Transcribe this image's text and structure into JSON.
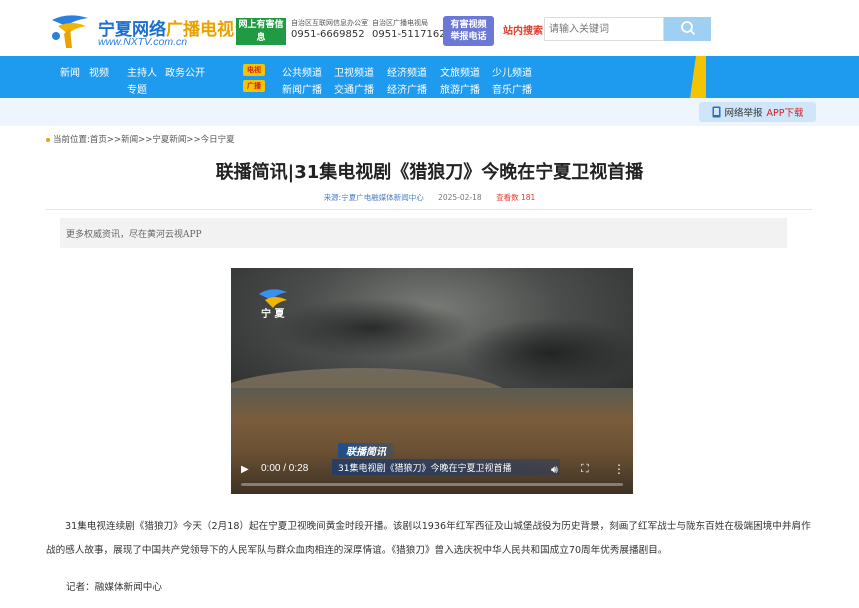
{
  "header": {
    "logo_name_a": "宁夏网络",
    "logo_name_b": "广播电视台",
    "logo_url": "www.NXTV.com.cn",
    "report_badge_line1": "网上有害信息",
    "report_badge_line2": "举报专区",
    "cyber_office": {
      "label": "自治区互联网信息办公室",
      "phone": "0951-6669852"
    },
    "radio_bureau": {
      "label": "自治区广播电视局",
      "phone": "0951-5117162"
    },
    "tv_badge_line1": "有害视频",
    "tv_badge_line2": "举报电话",
    "search_label": "站内搜索",
    "search_placeholder": "请输入关键词"
  },
  "nav": {
    "left_items": [
      "新闻",
      "视频",
      "主持人",
      "政务公开",
      "专题"
    ],
    "tv_tag": "电视",
    "radio_tag": "广播",
    "tv_channels": [
      "公共频道",
      "卫视频道",
      "经济频道",
      "文旅频道",
      "少儿频道"
    ],
    "radio_channels": [
      "新闻广播",
      "交通广播",
      "经济广播",
      "旅游广播",
      "音乐广播"
    ]
  },
  "subbar": {
    "app_label_black": "网络举报",
    "app_label_red": "APP下载"
  },
  "breadcrumb": "当前位置:首页>>新闻>>宁夏新闻>>今日宁夏",
  "article": {
    "title": "联播简讯|31集电视剧《猎狼刀》今晚在宁夏卫视首播",
    "source": "来源:宁夏广电融媒体新闻中心",
    "date": "2025-02-18",
    "views": "查看数 181",
    "note": "更多权威资讯，尽在黄河云视APP",
    "paragraph": "31集电视连续剧《猎狼刀》今天（2月18）起在宁夏卫视晚间黄金时段开播。该剧以1936年红军西征及山城堡战役为历史背景，刻画了红军战士与陇东百姓在极端困境中并肩作战的感人故事，展现了中国共产党领导下的人民军队与群众血肉相连的深厚情谊。《猎狼刀》曾入选庆祝中华人民共和国成立70周年优秀展播剧目。",
    "reporter": "记者：融媒体新闻中心"
  },
  "video": {
    "channel_logo": "宁 夏",
    "caption_tag": "联播简讯",
    "caption_text": "31集电视剧《猎狼刀》今晚在宁夏卫视首播",
    "time": "0:00 / 0:28",
    "progress": 0.0
  },
  "colors": {
    "nav_blue": "#1e9aef",
    "accent_yellow": "#f3c400",
    "alert_red": "#e63c2c",
    "report_green": "#1f9b43"
  },
  "icons": [
    "logo-mark",
    "search-icon",
    "phone-app-icon",
    "play-icon",
    "volume-icon",
    "fullscreen-icon",
    "more-icon"
  ]
}
